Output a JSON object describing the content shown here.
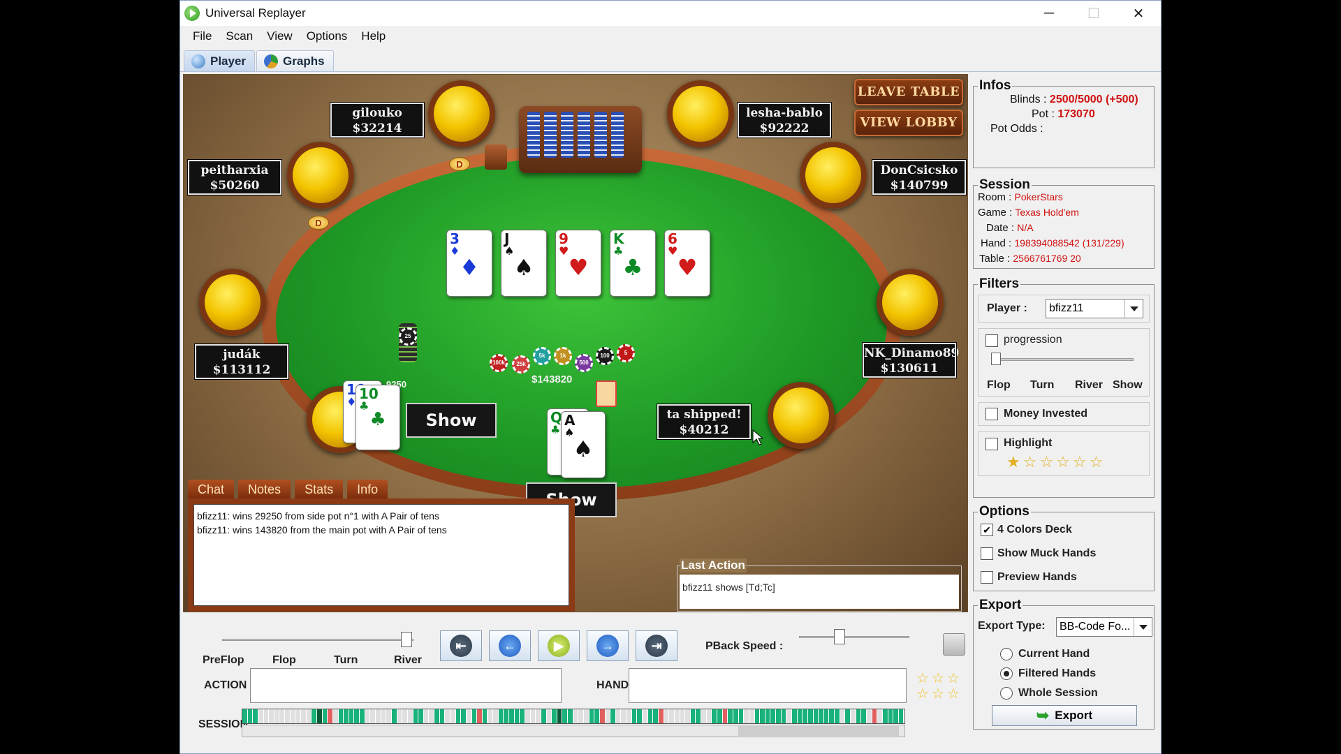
{
  "window": {
    "title": "Universal Replayer",
    "minimize": "─",
    "maximize": "☐",
    "close": "✕"
  },
  "menu": [
    "File",
    "Scan",
    "View",
    "Options",
    "Help"
  ],
  "tabs": [
    {
      "label": "Player"
    },
    {
      "label": "Graphs"
    }
  ],
  "table": {
    "leave_table": "LEAVE TABLE",
    "view_lobby": "VIEW LOBBY",
    "dealer_button": "D",
    "players": [
      {
        "name": "gilouko",
        "stack": "$32214"
      },
      {
        "name": "lesha-bablo",
        "stack": "$92222"
      },
      {
        "name": "peitharxia",
        "stack": "$50260"
      },
      {
        "name": "DonCsicsko",
        "stack": "$140799"
      },
      {
        "name": "judák",
        "stack": "$113112"
      },
      {
        "name": "NK_Dinamo89",
        "stack": "$130611"
      },
      {
        "name": "ta shipped!",
        "stack": "$40212"
      }
    ],
    "board": [
      {
        "rank": "3",
        "suit": "♦",
        "color": "blue"
      },
      {
        "rank": "J",
        "suit": "♠",
        "color": "black"
      },
      {
        "rank": "9",
        "suit": "♥",
        "color": "red"
      },
      {
        "rank": "K",
        "suit": "♣",
        "color": "green"
      },
      {
        "rank": "6",
        "suit": "♥",
        "color": "red"
      }
    ],
    "hole_cards_left": [
      {
        "rank": "10",
        "suit": "♦",
        "color": "blue"
      },
      {
        "rank": "10",
        "suit": "♣",
        "color": "green"
      }
    ],
    "hole_cards_center": [
      {
        "rank": "Q",
        "suit": "♣",
        "color": "green"
      },
      {
        "rank": "A",
        "suit": "♠",
        "color": "black"
      }
    ],
    "main_pot": "$143820",
    "side_pot_partial": "9250",
    "chip_labels": [
      "100k",
      "25k",
      "5k",
      "1k",
      "500",
      "100",
      "5",
      "25"
    ],
    "show_left": "Show",
    "show_center": "Show"
  },
  "chat": {
    "tabs": [
      "Chat",
      "Notes",
      "Stats",
      "Info"
    ],
    "lines": [
      "bfizz11: wins 29250 from side pot n°1 with A Pair of tens",
      "bfizz11: wins 143820 from the main pot with A Pair of tens"
    ]
  },
  "last_action": {
    "label": "Last Action",
    "text": "bfizz11 shows [Td;Tc]"
  },
  "infos": {
    "title": "Infos",
    "blinds_label": "Blinds :",
    "blinds": "2500/5000 (+500)",
    "pot_label": "Pot :",
    "pot": "173070",
    "pot_odds_label": "Pot Odds :"
  },
  "session": {
    "title": "Session",
    "room_label": "Room :",
    "room": "PokerStars",
    "game_label": "Game :",
    "game": "Texas Hold'em",
    "date_label": "Date :",
    "date": "N/A",
    "hand_label": "Hand :",
    "hand": "198394088542 (131/229)",
    "table_label": "Table :",
    "table": "2566761769 20"
  },
  "filters": {
    "title": "Filters",
    "player_label": "Player :",
    "player": "bfizz11",
    "progression": "progression",
    "progression_ticks": [
      "Flop",
      "Turn",
      "River",
      "Show"
    ],
    "money_invested": "Money Invested",
    "highlight": "Highlight",
    "highlight_stars": "★☆☆☆☆☆"
  },
  "options": {
    "title": "Options",
    "four_colors": "4 Colors Deck",
    "four_colors_checked": true,
    "show_muck": "Show Muck Hands",
    "preview": "Preview Hands"
  },
  "export": {
    "title": "Export",
    "type_label": "Export Type:",
    "type": "BB-Code Fo...",
    "current": "Current Hand",
    "filtered": "Filtered Hands",
    "whole": "Whole Session",
    "selected": "filtered",
    "button": "Export"
  },
  "controls": {
    "streets": [
      "PreFlop",
      "Flop",
      "Turn",
      "River"
    ],
    "pback_label": "PBack Speed :",
    "action_label": "ACTION",
    "hand_label": "HAND",
    "session_label": "SESSION"
  },
  "colors": {
    "accent_red": "#d01010",
    "felt": "#1f9a26",
    "strip_green": "#18b27a",
    "strip_red": "#e06060",
    "strip_dark": "#0a5a3a",
    "strip_gray": "#e0e0e0"
  },
  "session_strip": [
    "G",
    "G",
    "G",
    "W",
    "W",
    "W",
    "W",
    "W",
    "W",
    "W",
    "W",
    "W",
    "W",
    "G",
    "D",
    "G",
    "R",
    "W",
    "G",
    "G",
    "G",
    "G",
    "G",
    "W",
    "W",
    "W",
    "W",
    "W",
    "G",
    "W",
    "W",
    "W",
    "G",
    "G",
    "W",
    "W",
    "G",
    "G",
    "W",
    "W",
    "G",
    "G",
    "W",
    "G",
    "R",
    "G",
    "W",
    "W",
    "G",
    "G",
    "G",
    "G",
    "G",
    "W",
    "W",
    "W",
    "G",
    "W",
    "G",
    "D",
    "G",
    "G",
    "W",
    "W",
    "W",
    "G",
    "G",
    "R",
    "W",
    "G",
    "W",
    "W",
    "W",
    "G",
    "G",
    "W",
    "G",
    "G",
    "R",
    "W",
    "W",
    "W",
    "W",
    "W",
    "G",
    "G",
    "W",
    "W",
    "G",
    "G",
    "R",
    "G",
    "G",
    "G",
    "W",
    "W",
    "G",
    "G",
    "G",
    "G",
    "G",
    "G",
    "W",
    "G",
    "G",
    "G",
    "G",
    "G",
    "G",
    "G",
    "G",
    "G",
    "W",
    "G",
    "W",
    "G",
    "G",
    "W",
    "R",
    "W",
    "G",
    "G",
    "G",
    "G"
  ]
}
